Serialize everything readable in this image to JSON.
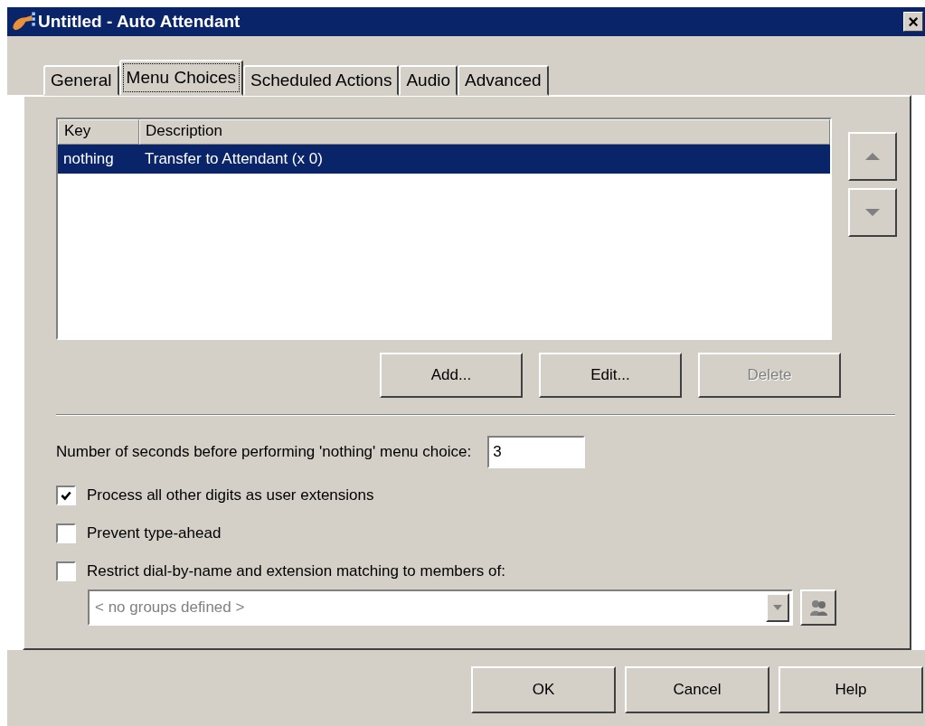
{
  "window": {
    "title": "Untitled - Auto Attendant",
    "close": "×"
  },
  "tabs": [
    {
      "label": "General",
      "selected": false
    },
    {
      "label": "Menu Choices",
      "selected": true
    },
    {
      "label": "Scheduled Actions",
      "selected": false
    },
    {
      "label": "Audio",
      "selected": false
    },
    {
      "label": "Advanced",
      "selected": false
    }
  ],
  "list": {
    "columns": [
      "Key",
      "Description"
    ],
    "rows": [
      {
        "key": "nothing",
        "description": "Transfer to Attendant (x 0)",
        "selected": true
      }
    ]
  },
  "list_buttons": [
    {
      "label": "Add...",
      "disabled": false
    },
    {
      "label": "Edit...",
      "disabled": false
    },
    {
      "label": "Delete",
      "disabled": true
    }
  ],
  "seconds": {
    "label": "Number of seconds before performing 'nothing' menu choice:",
    "value": "3"
  },
  "options": [
    {
      "label": "Process all other digits as user extensions",
      "checked": true
    },
    {
      "label": "Prevent type-ahead",
      "checked": false
    },
    {
      "label": "Restrict dial-by-name and extension matching to members of:",
      "checked": false
    }
  ],
  "groups": {
    "value": "< no groups defined >",
    "disabled": true
  },
  "dialog_buttons": [
    {
      "label": "OK"
    },
    {
      "label": "Cancel"
    },
    {
      "label": "Help"
    }
  ]
}
